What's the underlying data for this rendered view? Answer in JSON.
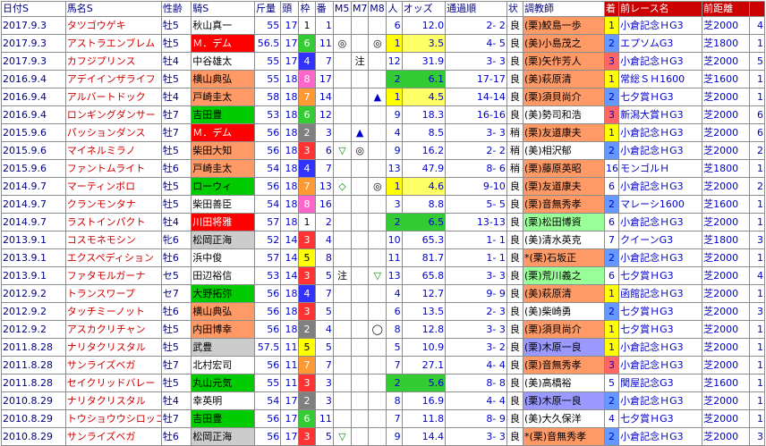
{
  "headers": [
    "日付S",
    "馬名S",
    "性齢",
    "騎S",
    "斤量",
    "頭",
    "枠",
    "番",
    "M5",
    "M7",
    "M8",
    "人",
    "オッズ",
    "通過順",
    "状",
    "調教師",
    "着",
    "前レース名",
    "前距離",
    ""
  ],
  "colors": {
    "frameBg": {
      "1": "#ffffff",
      "2": "#808080",
      "3": "#ff3333",
      "4": "#3333ff",
      "5": "#ffff00",
      "6": "#33cc33",
      "7": "#ff9933",
      "8": "#ff66cc"
    },
    "popYellow": "#ffff00",
    "popGreen": "#33cc33",
    "popGrey": "#cccccc",
    "oddsYellow": "#ffff66",
    "oddsGreen": "#33cc33",
    "jockeyBg": {
      "red": "#ff0000",
      "green": "#00cc00",
      "salmon": "#ff9966",
      "grey": "#cccccc",
      "white": "#ffffff"
    },
    "trainerBg": {
      "salmon": "#ff9966",
      "pink": "#ffcccc",
      "blue": "#9999ff",
      "green": "#99ff99",
      "white": "#ffffff"
    },
    "finBg": {
      "1": "#ffff00",
      "2": "#6699ff",
      "3": "#ff6666",
      "other": "#ffffff"
    }
  },
  "rows": [
    {
      "date": "2017.9.3",
      "horse": "タツゴウゲキ",
      "sex": "牡5",
      "jockey": "秋山真一",
      "jbg": "white",
      "weight": "55",
      "heads": "17",
      "frame": "1",
      "num": "1",
      "m5": "",
      "m7": "",
      "m8": "",
      "pop": "6",
      "popbg": "",
      "odds": "12.0",
      "oddsbg": "",
      "pos": "2- 2",
      "track": "良",
      "trainer": "(栗)鮫島一歩",
      "tbg": "salmon",
      "fin": "1",
      "race": "小倉記念ＨG3",
      "dist": "芝2000",
      "last": "4"
    },
    {
      "date": "2017.9.3",
      "horse": "アストラエンブレム",
      "sex": "牡5",
      "jockey": "Ｍ．デム",
      "jbg": "red",
      "weight": "56.5",
      "heads": "17",
      "frame": "6",
      "num": "11",
      "m5": "◎",
      "m7": "",
      "m8": "◎",
      "pop": "1",
      "popbg": "yellow",
      "odds": "3.5",
      "oddsbg": "yellow",
      "pos": "4- 5",
      "track": "良",
      "trainer": "(美)小島茂之",
      "tbg": "salmon",
      "fin": "2",
      "race": "エプソムG3",
      "dist": "芝1800",
      "last": "1"
    },
    {
      "date": "2017.9.3",
      "horse": "カフジプリンス",
      "sex": "牡4",
      "jockey": "中谷雄太",
      "jbg": "white",
      "weight": "55",
      "heads": "17",
      "frame": "4",
      "num": "7",
      "m5": "",
      "m7": "注",
      "m8": "",
      "pop": "12",
      "popbg": "",
      "odds": "31.9",
      "oddsbg": "",
      "pos": "3- 3",
      "track": "良",
      "trainer": "(栗)矢作芳人",
      "tbg": "salmon",
      "fin": "3",
      "race": "小倉記念ＨG3",
      "dist": "芝2000",
      "last": "5"
    },
    {
      "date": "2016.9.4",
      "horse": "アデイインザライフ",
      "sex": "牡5",
      "jockey": "横山典弘",
      "jbg": "salmon",
      "weight": "55",
      "heads": "18",
      "frame": "8",
      "num": "17",
      "m5": "",
      "m7": "",
      "m8": "",
      "pop": "2",
      "popbg": "green",
      "odds": "6.1",
      "oddsbg": "green",
      "pos": "17-17",
      "track": "良",
      "trainer": "(美)萩原清",
      "tbg": "salmon",
      "fin": "1",
      "race": "常総ＳＨ1600",
      "dist": "芝1600",
      "last": "1"
    },
    {
      "date": "2016.9.4",
      "horse": "アルバートドック",
      "sex": "牡4",
      "jockey": "戸崎圭太",
      "jbg": "salmon",
      "weight": "58",
      "heads": "18",
      "frame": "7",
      "num": "14",
      "m5": "",
      "m7": "",
      "m8": "▲",
      "pop": "1",
      "popbg": "yellow",
      "odds": "4.5",
      "oddsbg": "yellow",
      "pos": "14-14",
      "track": "良",
      "trainer": "(栗)須貝尚介",
      "tbg": "salmon",
      "fin": "2",
      "race": "七夕賞ＨG3",
      "dist": "芝2000",
      "last": "1"
    },
    {
      "date": "2016.9.4",
      "horse": "ロンギングダンサー",
      "sex": "牡7",
      "jockey": "吉田豊",
      "jbg": "green",
      "weight": "53",
      "heads": "18",
      "frame": "6",
      "num": "12",
      "m5": "",
      "m7": "",
      "m8": "",
      "pop": "9",
      "popbg": "",
      "odds": "18.3",
      "oddsbg": "",
      "pos": "16-16",
      "track": "良",
      "trainer": "(美)勢司和浩",
      "tbg": "white",
      "fin": "3",
      "race": "新潟大賞ＨG3",
      "dist": "芝2000",
      "last": "6"
    },
    {
      "date": "2015.9.6",
      "horse": "パッションダンス",
      "sex": "牡7",
      "jockey": "Ｍ．デム",
      "jbg": "red",
      "weight": "56",
      "heads": "18",
      "frame": "2",
      "num": "3",
      "m5": "",
      "m7": "▲",
      "m8": "",
      "pop": "4",
      "popbg": "",
      "odds": "8.5",
      "oddsbg": "",
      "pos": "3- 3",
      "track": "稍",
      "trainer": "(栗)友道康夫",
      "tbg": "salmon",
      "fin": "1",
      "race": "小倉記念ＨG3",
      "dist": "芝2000",
      "last": "6"
    },
    {
      "date": "2015.9.6",
      "horse": "マイネルミラノ",
      "sex": "牡5",
      "jockey": "柴田大知",
      "jbg": "salmon",
      "weight": "56",
      "heads": "18",
      "frame": "3",
      "num": "6",
      "m5": "▽",
      "m7": "◎",
      "m8": "",
      "pop": "9",
      "popbg": "",
      "odds": "16.2",
      "oddsbg": "",
      "pos": "2- 2",
      "track": "稍",
      "trainer": "(美)相沢郁",
      "tbg": "white",
      "fin": "2",
      "race": "小倉記念ＨG3",
      "dist": "芝2000",
      "last": "2"
    },
    {
      "date": "2015.9.6",
      "horse": "ファントムライト",
      "sex": "牡6",
      "jockey": "戸崎圭太",
      "jbg": "salmon",
      "weight": "54",
      "heads": "18",
      "frame": "4",
      "num": "7",
      "m5": "",
      "m7": "",
      "m8": "",
      "pop": "13",
      "popbg": "",
      "odds": "47.9",
      "oddsbg": "",
      "pos": "8- 6",
      "track": "稍",
      "trainer": "(栗)藤原英昭",
      "tbg": "salmon",
      "fin": "16",
      "race": "モンゴルＨ",
      "dist": "芝1800",
      "last": "1"
    },
    {
      "date": "2014.9.7",
      "horse": "マーティンボロ",
      "sex": "牡5",
      "jockey": "ローウィ",
      "jbg": "green",
      "weight": "56",
      "heads": "18",
      "frame": "7",
      "num": "13",
      "m5": "◇",
      "m7": "",
      "m8": "◎",
      "pop": "1",
      "popbg": "yellow",
      "odds": "4.6",
      "oddsbg": "yellow",
      "pos": "9-10",
      "track": "良",
      "trainer": "(栗)友道康夫",
      "tbg": "salmon",
      "fin": "6",
      "race": "小倉記念ＨG3",
      "dist": "芝2000",
      "last": "2"
    },
    {
      "date": "2014.9.7",
      "horse": "クランモンタナ",
      "sex": "牡5",
      "jockey": "柴田善臣",
      "jbg": "white",
      "weight": "54",
      "heads": "18",
      "frame": "8",
      "num": "16",
      "m5": "",
      "m7": "",
      "m8": "",
      "pop": "3",
      "popbg": "",
      "odds": "8.8",
      "oddsbg": "",
      "pos": "5- 5",
      "track": "良",
      "trainer": "(栗)音無秀孝",
      "tbg": "salmon",
      "fin": "2",
      "race": "マレーシ1600",
      "dist": "芝1600",
      "last": "1"
    },
    {
      "date": "2014.9.7",
      "horse": "ラストインパクト",
      "sex": "牡4",
      "jockey": "川田将雅",
      "jbg": "red",
      "weight": "57",
      "heads": "18",
      "frame": "1",
      "num": "2",
      "m5": "",
      "m7": "",
      "m8": "",
      "pop": "2",
      "popbg": "green",
      "odds": "6.5",
      "oddsbg": "green",
      "pos": "13-13",
      "track": "良",
      "trainer": "(栗)松田博資",
      "tbg": "green",
      "fin": "6",
      "race": "小倉記念ＨG3",
      "dist": "芝2000",
      "last": "1"
    },
    {
      "date": "2013.9.1",
      "horse": "コスモネモシン",
      "sex": "牝6",
      "jockey": "松岡正海",
      "jbg": "grey",
      "weight": "52",
      "heads": "14",
      "frame": "3",
      "num": "4",
      "m5": "",
      "m7": "",
      "m8": "",
      "pop": "10",
      "popbg": "",
      "odds": "65.3",
      "oddsbg": "",
      "pos": "1- 1",
      "track": "良",
      "trainer": "(美)清水英克",
      "tbg": "white",
      "fin": "7",
      "race": "クイーンG3",
      "dist": "芝1800",
      "last": "3"
    },
    {
      "date": "2013.9.1",
      "horse": "エクスペディション",
      "sex": "牡6",
      "jockey": "浜中俊",
      "jbg": "white",
      "weight": "57",
      "heads": "14",
      "frame": "5",
      "num": "8",
      "m5": "",
      "m7": "",
      "m8": "",
      "pop": "11",
      "popbg": "",
      "odds": "81.7",
      "oddsbg": "",
      "pos": "1- 1",
      "track": "良",
      "trainer": "*(栗)石坂正",
      "tbg": "salmon",
      "fin": "2",
      "race": "小倉記念ＨG3",
      "dist": "芝2000",
      "last": "1"
    },
    {
      "date": "2013.9.1",
      "horse": "ファタモルガーナ",
      "sex": "セ5",
      "jockey": "田辺裕信",
      "jbg": "white",
      "weight": "53",
      "heads": "14",
      "frame": "3",
      "num": "5",
      "m5": "注",
      "m7": "",
      "m8": "▽",
      "pop": "13",
      "popbg": "",
      "odds": "65.8",
      "oddsbg": "",
      "pos": "3- 3",
      "track": "良",
      "trainer": "(栗)荒川義之",
      "tbg": "green",
      "fin": "6",
      "race": "七夕賞ＨG3",
      "dist": "芝2000",
      "last": "4"
    },
    {
      "date": "2012.9.2",
      "horse": "トランスワープ",
      "sex": "セ7",
      "jockey": "大野拓弥",
      "jbg": "green",
      "weight": "56",
      "heads": "18",
      "frame": "4",
      "num": "7",
      "m5": "",
      "m7": "",
      "m8": "",
      "pop": "4",
      "popbg": "",
      "odds": "12.7",
      "oddsbg": "",
      "pos": "9- 9",
      "track": "良",
      "trainer": "(美)萩原清",
      "tbg": "salmon",
      "fin": "1",
      "race": "函館記念ＨG3",
      "dist": "芝2000",
      "last": "1"
    },
    {
      "date": "2012.9.2",
      "horse": "タッチミーノット",
      "sex": "牡6",
      "jockey": "横山典弘",
      "jbg": "salmon",
      "weight": "56",
      "heads": "18",
      "frame": "3",
      "num": "5",
      "m5": "",
      "m7": "",
      "m8": "",
      "pop": "6",
      "popbg": "",
      "odds": "13.5",
      "oddsbg": "",
      "pos": "2- 3",
      "track": "良",
      "trainer": "(美)柴崎勇",
      "tbg": "white",
      "fin": "2",
      "race": "七夕賞ＨG3",
      "dist": "芝2000",
      "last": "3"
    },
    {
      "date": "2012.9.2",
      "horse": "アスカクリチャン",
      "sex": "牡5",
      "jockey": "内田博幸",
      "jbg": "salmon",
      "weight": "56",
      "heads": "18",
      "frame": "2",
      "num": "4",
      "m5": "",
      "m7": "",
      "m8": "◯",
      "pop": "8",
      "popbg": "",
      "odds": "12.8",
      "oddsbg": "",
      "pos": "3- 3",
      "track": "良",
      "trainer": "(栗)須貝尚介",
      "tbg": "salmon",
      "fin": "1",
      "race": "七夕賞ＨG3",
      "dist": "芝2000",
      "last": "1"
    },
    {
      "date": "2011.8.28",
      "horse": "ナリタクリスタル",
      "sex": "牡5",
      "jockey": "武豊",
      "jbg": "grey",
      "weight": "57.5",
      "heads": "11",
      "frame": "5",
      "num": "5",
      "m5": "",
      "m7": "",
      "m8": "",
      "pop": "5",
      "popbg": "",
      "odds": "10.9",
      "oddsbg": "",
      "pos": "3- 2",
      "track": "良",
      "trainer": "(栗)木原一良",
      "tbg": "blue",
      "fin": "1",
      "race": "小倉記念ＨG3",
      "dist": "芝2000",
      "last": "1"
    },
    {
      "date": "2011.8.28",
      "horse": "サンライズベガ",
      "sex": "牡7",
      "jockey": "北村宏司",
      "jbg": "white",
      "weight": "56",
      "heads": "11",
      "frame": "7",
      "num": "7",
      "m5": "",
      "m7": "",
      "m8": "",
      "pop": "7",
      "popbg": "",
      "odds": "27.1",
      "oddsbg": "",
      "pos": "4- 4",
      "track": "良",
      "trainer": "(栗)音無秀孝",
      "tbg": "salmon",
      "fin": "3",
      "race": "小倉記念ＨG3",
      "dist": "芝2000",
      "last": "1"
    },
    {
      "date": "2011.8.28",
      "horse": "セイクリッドバレー",
      "sex": "牡5",
      "jockey": "丸山元気",
      "jbg": "green",
      "weight": "55",
      "heads": "11",
      "frame": "3",
      "num": "3",
      "m5": "",
      "m7": "",
      "m8": "",
      "pop": "2",
      "popbg": "green",
      "odds": "5.6",
      "oddsbg": "green",
      "pos": "8- 8",
      "track": "良",
      "trainer": "(美)高橋裕",
      "tbg": "white",
      "fin": "5",
      "race": "関屋記念G3",
      "dist": "芝1600",
      "last": "1"
    },
    {
      "date": "2010.8.29",
      "horse": "ナリタクリスタル",
      "sex": "牡4",
      "jockey": "幸英明",
      "jbg": "white",
      "weight": "54",
      "heads": "17",
      "frame": "2",
      "num": "3",
      "m5": "",
      "m7": "",
      "m8": "",
      "pop": "8",
      "popbg": "",
      "odds": "16.9",
      "oddsbg": "",
      "pos": "4- 4",
      "track": "良",
      "trainer": "(栗)木原一良",
      "tbg": "blue",
      "fin": "2",
      "race": "小倉記念ＨG3",
      "dist": "芝2000",
      "last": "1"
    },
    {
      "date": "2010.8.29",
      "horse": "トウショウウシロッコ",
      "sex": "牡7",
      "jockey": "吉田豊",
      "jbg": "green",
      "weight": "56",
      "heads": "17",
      "frame": "6",
      "num": "11",
      "m5": "",
      "m7": "",
      "m8": "",
      "pop": "7",
      "popbg": "",
      "odds": "11.8",
      "oddsbg": "",
      "pos": "8- 9",
      "track": "良",
      "trainer": "(美)大久保洋",
      "tbg": "white",
      "fin": "4",
      "race": "七夕賞ＨG3",
      "dist": "芝2000",
      "last": "1"
    },
    {
      "date": "2010.8.29",
      "horse": "サンライズベガ",
      "sex": "牡6",
      "jockey": "松岡正海",
      "jbg": "grey",
      "weight": "56",
      "heads": "17",
      "frame": "3",
      "num": "5",
      "m5": "▽",
      "m7": "",
      "m8": "",
      "pop": "9",
      "popbg": "",
      "odds": "14.4",
      "oddsbg": "",
      "pos": "3- 3",
      "track": "良",
      "trainer": "*(栗)音無秀孝",
      "tbg": "salmon",
      "fin": "2",
      "race": "小倉記念ＨG3",
      "dist": "芝2000",
      "last": "3"
    }
  ]
}
